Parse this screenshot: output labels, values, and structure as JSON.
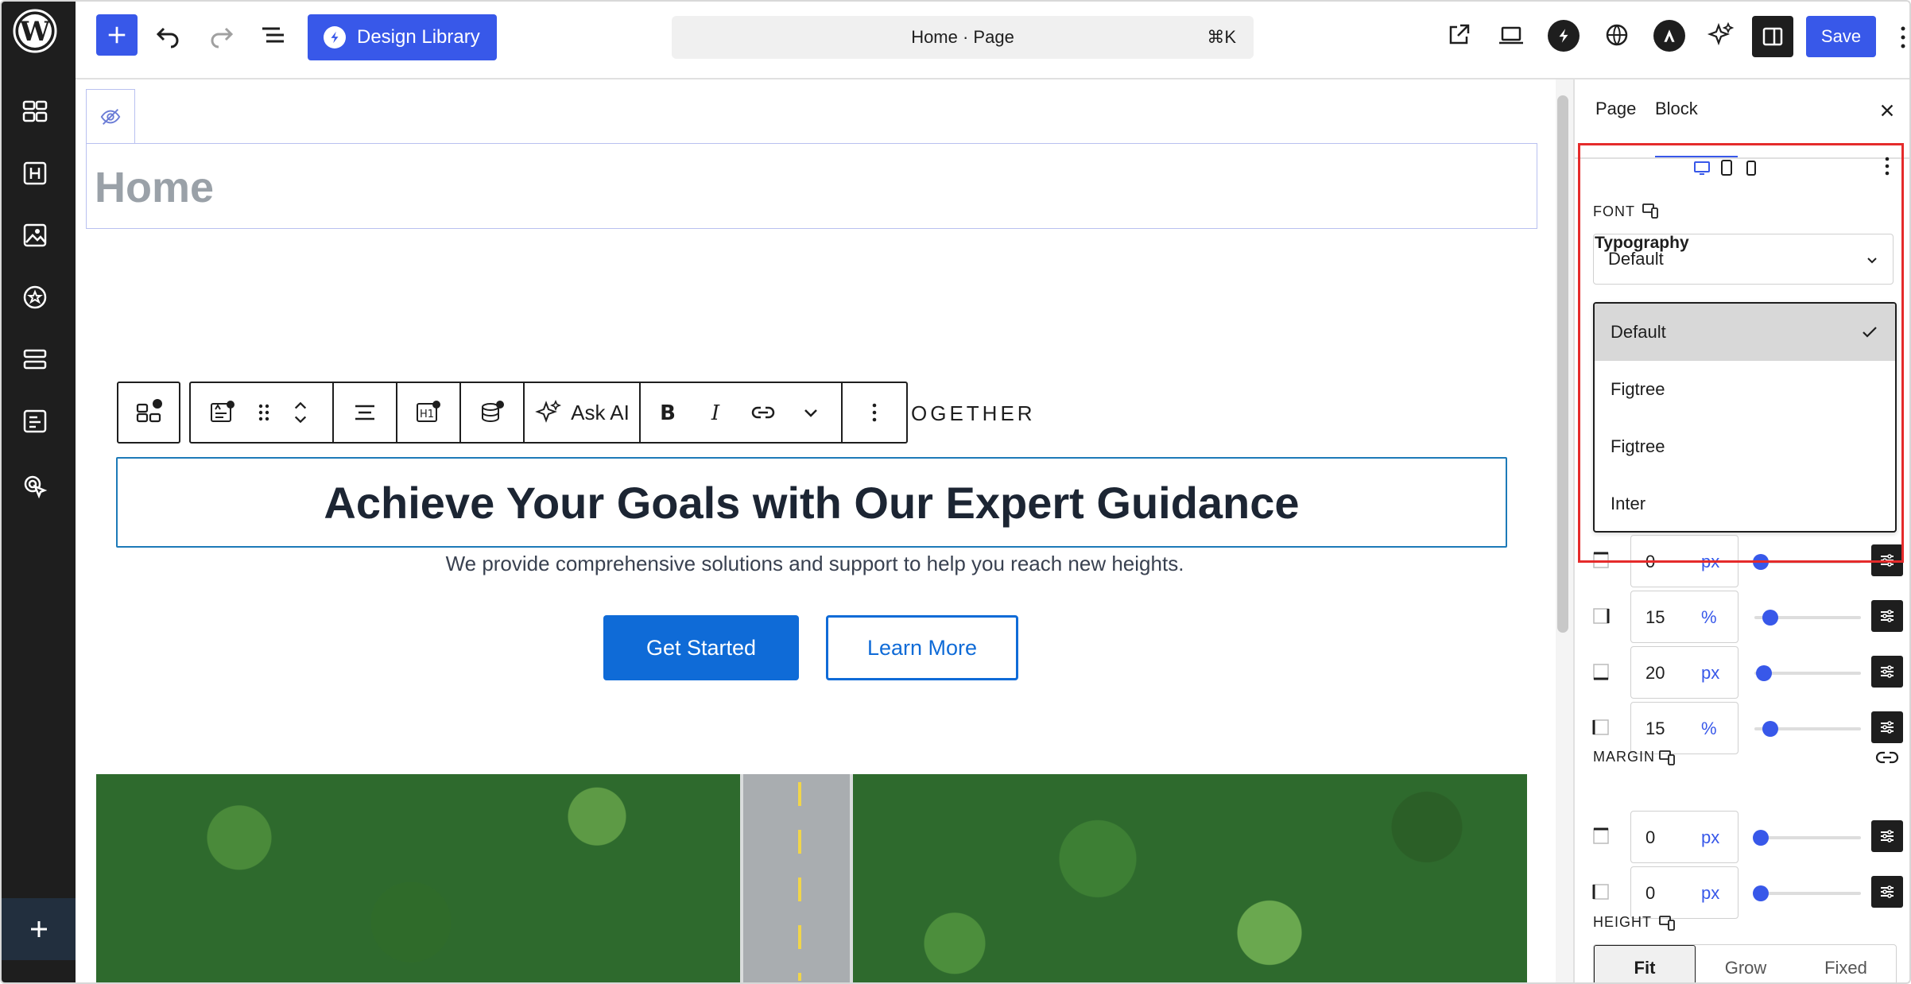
{
  "topbar": {
    "design_library_label": "Design Library",
    "doc_title": "Home · Page",
    "shortcut": "⌘K",
    "save_label": "Save"
  },
  "canvas": {
    "page_title": "Home",
    "eyebrow": "OGETHER",
    "heading": "Achieve Your Goals with Our Expert Guidance",
    "subtext": "We provide comprehensive solutions and support to help you reach new heights.",
    "primary_button": "Get Started",
    "secondary_button": "Learn More"
  },
  "block_toolbar": {
    "ask_ai_label": "Ask AI"
  },
  "settings": {
    "tabs": [
      {
        "label": "Page",
        "active": false
      },
      {
        "label": "Block",
        "active": true
      }
    ],
    "typography_title": "Typography",
    "font_label": "FONT",
    "font_selected": "Default",
    "font_options": [
      {
        "label": "Default",
        "selected": true
      },
      {
        "label": "Figtree",
        "selected": false
      },
      {
        "label": "Figtree",
        "selected": false
      },
      {
        "label": "Inter",
        "selected": false
      }
    ],
    "padding_rows": [
      {
        "value": "0",
        "unit": "px",
        "slider_fraction": 0.0
      },
      {
        "value": "15",
        "unit": "%",
        "slider_fraction": 0.15
      },
      {
        "value": "20",
        "unit": "px",
        "slider_fraction": 0.05
      },
      {
        "value": "15",
        "unit": "%",
        "slider_fraction": 0.15
      }
    ],
    "margin_label": "MARGIN",
    "margin_rows": [
      {
        "value": "0",
        "unit": "px",
        "slider_fraction": 0.0
      },
      {
        "value": "0",
        "unit": "px",
        "slider_fraction": 0.0
      }
    ],
    "height_label": "HEIGHT",
    "height_options": [
      {
        "label": "Fit",
        "active": true
      },
      {
        "label": "Grow",
        "active": false
      },
      {
        "label": "Fixed",
        "active": false
      }
    ]
  },
  "colors": {
    "accent": "#3858e9",
    "cta": "#0f6bd7",
    "highlight": "#e52b2b",
    "sidebar_bg": "#1e1e1e"
  }
}
